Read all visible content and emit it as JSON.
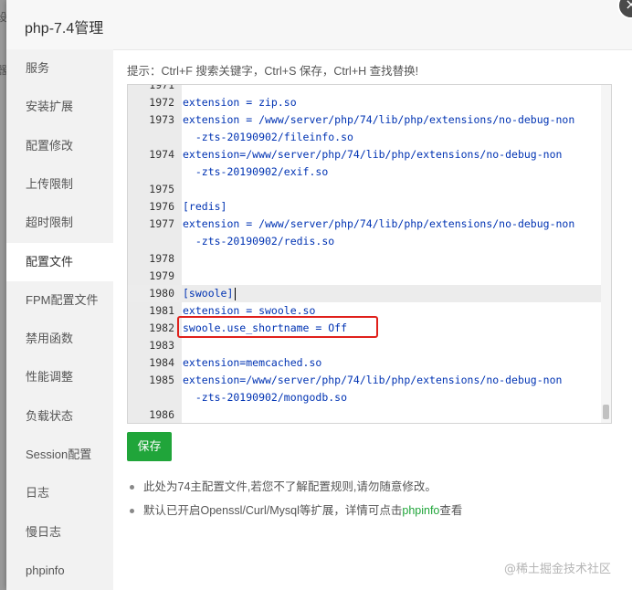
{
  "background": {
    "partial_text": "设"
  },
  "dialog": {
    "title": "php-7.4管理",
    "close_symbol": "×"
  },
  "sidebar": {
    "active_index": 5,
    "items": [
      {
        "label": "服务"
      },
      {
        "label": "安装扩展"
      },
      {
        "label": "配置修改"
      },
      {
        "label": "上传限制"
      },
      {
        "label": "超时限制"
      },
      {
        "label": "配置文件"
      },
      {
        "label": "FPM配置文件"
      },
      {
        "label": "禁用函数"
      },
      {
        "label": "性能调整"
      },
      {
        "label": "负载状态"
      },
      {
        "label": "Session配置"
      },
      {
        "label": "日志"
      },
      {
        "label": "慢日志"
      },
      {
        "label": "phpinfo"
      }
    ]
  },
  "main": {
    "hint": "提示：Ctrl+F 搜索关键字，Ctrl+S 保存，Ctrl+H 查找替换!",
    "editor": {
      "highlighted_line": "1980",
      "boxed_line": "1982",
      "lines": [
        {
          "num": "1971",
          "text": ""
        },
        {
          "num": "1972",
          "text": "extension = zip.so"
        },
        {
          "num": "1973",
          "text": "extension = /www/server/php/74/lib/php/extensions/no-debug-non"
        },
        {
          "num": "",
          "text": "  -zts-20190902/fileinfo.so"
        },
        {
          "num": "1974",
          "text": "extension=/www/server/php/74/lib/php/extensions/no-debug-non"
        },
        {
          "num": "",
          "text": "  -zts-20190902/exif.so"
        },
        {
          "num": "1975",
          "text": ""
        },
        {
          "num": "1976",
          "text": "[redis]"
        },
        {
          "num": "1977",
          "text": "extension = /www/server/php/74/lib/php/extensions/no-debug-non"
        },
        {
          "num": "",
          "text": "  -zts-20190902/redis.so"
        },
        {
          "num": "1978",
          "text": ""
        },
        {
          "num": "1979",
          "text": ""
        },
        {
          "num": "1980",
          "text": "[swoole]"
        },
        {
          "num": "1981",
          "text": "extension = swoole.so"
        },
        {
          "num": "1982",
          "text": "swoole.use_shortname = Off"
        },
        {
          "num": "1983",
          "text": ""
        },
        {
          "num": "1984",
          "text": "extension=memcached.so"
        },
        {
          "num": "1985",
          "text": "extension=/www/server/php/74/lib/php/extensions/no-debug-non"
        },
        {
          "num": "",
          "text": "  -zts-20190902/mongodb.so"
        },
        {
          "num": "1986",
          "text": ""
        }
      ]
    },
    "save_label": "保存",
    "notes": {
      "note1": "此处为74主配置文件,若您不了解配置规则,请勿随意修改。",
      "note2_prefix": "默认已开启Openssl/Curl/Mysql等扩展，详情可点击",
      "note2_link": "phpinfo",
      "note2_suffix": "查看"
    }
  },
  "watermark": "@稀土掘金技术社区",
  "colors": {
    "accent_green": "#20a53a",
    "annotation_red": "#e0201b",
    "code_blue": "#0033b3"
  }
}
